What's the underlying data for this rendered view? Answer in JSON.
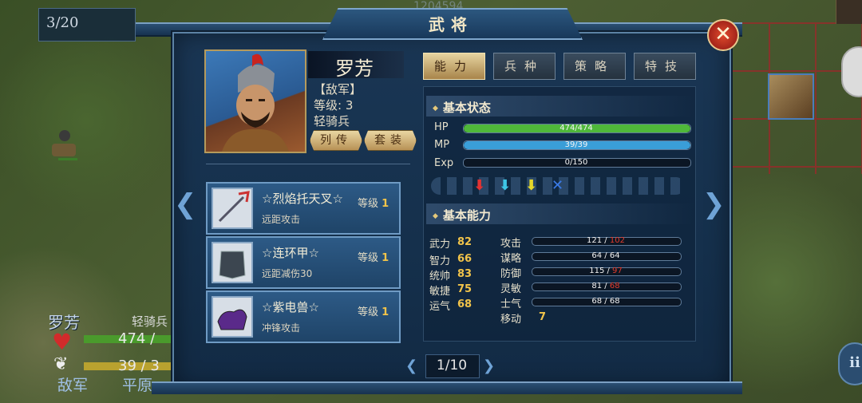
{
  "map": {
    "turn": "3/20",
    "faint_number": "1204594"
  },
  "dialog": {
    "title": "武将",
    "close_icon": "close-icon"
  },
  "general": {
    "name": "罗芳",
    "side": "【敌军】",
    "level_text": "等级: 3",
    "class": "轻骑兵",
    "buttons": {
      "biography": "列传",
      "outfit": "套装"
    }
  },
  "equipment": [
    {
      "name": "☆烈焰托天叉☆",
      "level_label": "等级",
      "level": "1",
      "desc": "远距攻击",
      "icon": "trident-icon"
    },
    {
      "name": "☆连环甲☆",
      "level_label": "等级",
      "level": "1",
      "desc": "远距减伤30",
      "icon": "armor-icon"
    },
    {
      "name": "☆紫电兽☆",
      "level_label": "等级",
      "level": "1",
      "desc": "冲锋攻击",
      "icon": "beast-mount-icon"
    }
  ],
  "tabs": [
    {
      "label": "能力",
      "active": true
    },
    {
      "label": "兵种",
      "active": false
    },
    {
      "label": "策略",
      "active": false
    },
    {
      "label": "特技",
      "active": false
    }
  ],
  "basic_status": {
    "title": "基本状态",
    "bars": [
      {
        "label": "HP",
        "text": "474/474",
        "fraction": 1.0,
        "color": "#4fb83a"
      },
      {
        "label": "MP",
        "text": "39/39",
        "fraction": 1.0,
        "color": "#3a9ed8"
      },
      {
        "label": "Exp",
        "text": "0/150",
        "fraction": 0.0,
        "color": "#c9a232"
      }
    ],
    "modifier_arrows": [
      {
        "icon": "red-down-arrow-icon",
        "glyph": "⬇",
        "color": "#e23232"
      },
      {
        "icon": "cyan-down-arrow-icon",
        "glyph": "⬇",
        "color": "#3ec6e6"
      },
      {
        "icon": "yellow-down-arrow-icon",
        "glyph": "⬇",
        "color": "#e6d82a"
      },
      {
        "icon": "blue-cross-icon",
        "glyph": "✕",
        "color": "#3a7ae6"
      }
    ]
  },
  "basic_ability": {
    "title": "基本能力",
    "attributes": [
      {
        "label": "武力",
        "value": "82"
      },
      {
        "label": "智力",
        "value": "66"
      },
      {
        "label": "统帅",
        "value": "83"
      },
      {
        "label": "敏捷",
        "value": "75"
      },
      {
        "label": "运气",
        "value": "68"
      }
    ],
    "derived": [
      {
        "label": "攻击",
        "base": "121",
        "sep": " / ",
        "modified": "102",
        "modified_red": true
      },
      {
        "label": "谋略",
        "base": "64",
        "sep": " / ",
        "modified": "64",
        "modified_red": false
      },
      {
        "label": "防御",
        "base": "115",
        "sep": " / ",
        "modified": "97",
        "modified_red": true
      },
      {
        "label": "灵敏",
        "base": "81",
        "sep": " / ",
        "modified": "68",
        "modified_red": true
      },
      {
        "label": "士气",
        "base": "68",
        "sep": " / ",
        "modified": "68",
        "modified_red": false
      }
    ],
    "move": {
      "label": "移动",
      "value": "7"
    }
  },
  "pager": {
    "text": "1/10"
  },
  "bottom_unit": {
    "name": "罗芳",
    "class": "轻骑兵",
    "hp": "474 /",
    "mp": "39 / 3",
    "side": "敌军",
    "terrain": "平原"
  }
}
